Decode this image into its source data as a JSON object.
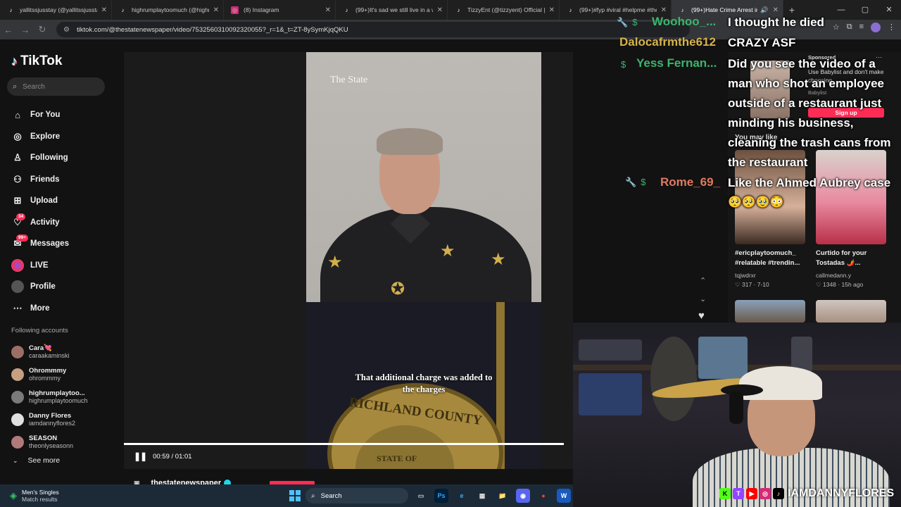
{
  "browser": {
    "tabs": [
      {
        "title": "yallitssjusstay (@yallitssjusstay)",
        "favicon": "tiktok-icon"
      },
      {
        "title": "highrumplaytoomuch (@highru",
        "favicon": "tiktok-icon"
      },
      {
        "title": "(8) Instagram",
        "favicon": "instagram-icon"
      },
      {
        "title": "(99+)It's sad we still live in a wo",
        "favicon": "tiktok-icon"
      },
      {
        "title": "TizzyEnt (@tizzyent) Official | Ti",
        "favicon": "tiktok-icon"
      },
      {
        "title": "(99+)#fyp #viral #helpme #the",
        "favicon": "tiktok-icon"
      },
      {
        "title": "(99+)Hate Crime Arrest in R",
        "favicon": "tiktok-icon",
        "active": true
      }
    ],
    "new_tab": "+",
    "url": "tiktok.com/@thestatenewspaper/video/7532560310092320055?_r=1&_t=ZT-8ySymKjqQKU"
  },
  "sidebar": {
    "logo": "TikTok",
    "search_placeholder": "Search",
    "nav": [
      {
        "label": "For You",
        "icon": "home-icon",
        "glyph": "⌂"
      },
      {
        "label": "Explore",
        "icon": "compass-icon",
        "glyph": "◎"
      },
      {
        "label": "Following",
        "icon": "following-icon",
        "glyph": "♙"
      },
      {
        "label": "Friends",
        "icon": "friends-icon",
        "glyph": "⚇"
      },
      {
        "label": "Upload",
        "icon": "upload-icon",
        "glyph": "⊞"
      },
      {
        "label": "Activity",
        "icon": "activity-icon",
        "glyph": "♡",
        "badge": "34"
      },
      {
        "label": "Messages",
        "icon": "messages-icon",
        "glyph": "✉",
        "badge": "99+"
      },
      {
        "label": "LIVE",
        "icon": "live-icon"
      },
      {
        "label": "Profile",
        "icon": "profile-icon"
      },
      {
        "label": "More",
        "icon": "more-icon",
        "glyph": "⋯"
      }
    ],
    "following_title": "Following accounts",
    "following": [
      {
        "name": "Cara💘",
        "handle": "caraakaminski",
        "color": "#9c6f66"
      },
      {
        "name": "Ohrommmy",
        "handle": "ohrommmy",
        "color": "#c4a080"
      },
      {
        "name": "highrumplaytoo...",
        "handle": "highrumplaytoomuch",
        "color": "#7a7a7a"
      },
      {
        "name": "Danny Flores",
        "handle": "iamdannyflores2",
        "color": "#e0e0e0"
      },
      {
        "name": "SEASON",
        "handle": "theonlyseasonn",
        "color": "#b07a7a"
      }
    ],
    "see_more": "See more"
  },
  "video": {
    "watermark": "The State",
    "subtitle_line1": "That additional charge was added to",
    "subtitle_line2": "the charges",
    "seal_text": "RICHLAND COUNTY",
    "seal_text2": "STATE OF",
    "progress": 0.98,
    "time": "00:59 / 01:01",
    "author": "thestatenewspaper"
  },
  "ad": {
    "label": "Sponsored",
    "text": "Use Babylist and don't make choosing...",
    "brand": "Babylist",
    "cta": "Sign up"
  },
  "recommendations": {
    "title": "You may like",
    "items": [
      {
        "title_l1": "#ericplaytoomuch_",
        "title_l2": "#relatable #trendin...",
        "author": "tqjwdrxr",
        "likes": "317",
        "age": "7-10"
      },
      {
        "title_l1": "Curtido for your",
        "title_l2": "Tostadas 🌶️...",
        "author": "callmedann.y",
        "likes": "1348",
        "age": "15h ago"
      }
    ]
  },
  "chat": [
    {
      "user": "Woohoo_...",
      "color": "#3bb56e"
    },
    {
      "user": "Dalocafrmthe612",
      "color": "#d6b34a"
    },
    {
      "user": "Yess Fernan...",
      "color": "#3bb56e"
    },
    {
      "user": "Rome_69_",
      "color": "#e07a5f"
    }
  ],
  "chat_messages": {
    "m1": "I thought he died",
    "m2": "CRAZY ASF",
    "m3_l1": "Did you see the video of a",
    "m3_l2": "man who shot an employee",
    "m3_l3": "outside of a restaurant just",
    "m3_l4": "minding his business,",
    "m3_l5": "cleaning the trash cans from",
    "m3_l6": "the restaurant",
    "m4": "Like the Ahmed Aubrey case",
    "m4_emotes": "🥺🥺🥹😳"
  },
  "stream": {
    "handle": "IAMDANNYFLORES",
    "socials": [
      "K",
      "T",
      "▶",
      "◎",
      "♪"
    ]
  },
  "taskbar": {
    "weather_l1": "Men's Singles",
    "weather_l2": "Match results",
    "search": "Search",
    "apps": [
      "▭",
      "Ps",
      "e",
      "▦",
      "📁",
      "◉",
      "●",
      "W"
    ]
  }
}
